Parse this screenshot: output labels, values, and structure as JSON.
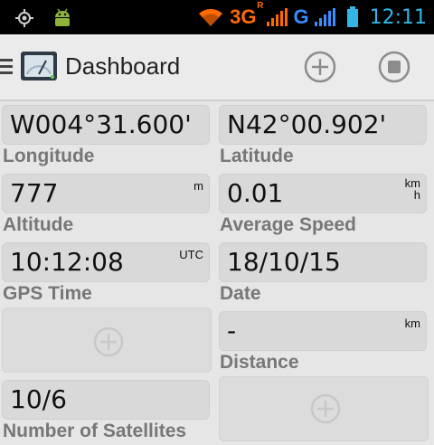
{
  "statusbar": {
    "left_icons": [
      "gps-target-icon",
      "android-debug-icon"
    ],
    "right_icons": [
      "wifi-icon",
      "signal-bars-orange-icon",
      "signal-bars-blue-icon",
      "battery-icon"
    ],
    "network_3g": "3G",
    "network_r": "R",
    "network_g": "G",
    "time": "12:11",
    "colors": {
      "wifi": "#ff6a00",
      "three_g": "#ff6a00",
      "g": "#3a8cff",
      "battery": "#33b5e5",
      "clock": "#33b5e5"
    }
  },
  "actionbar": {
    "title": "Dashboard",
    "icons": [
      "menu-icon",
      "dashboard-gauge-icon",
      "add-circle-icon",
      "stop-circle-icon"
    ]
  },
  "dashboard": {
    "longitude": {
      "value": "W004°31.600'",
      "unit": "",
      "label": "Longitude"
    },
    "latitude": {
      "value": "N42°00.902'",
      "unit": "",
      "label": "Latitude"
    },
    "altitude": {
      "value": "777",
      "unit": "m",
      "label": "Altitude"
    },
    "average_speed": {
      "value": "0.01",
      "unit_top": "km",
      "unit_bottom": "h",
      "label": "Average Speed"
    },
    "gps_time": {
      "value": "10:12:08",
      "unit": "UTC",
      "label": "GPS Time"
    },
    "date": {
      "value": "18/10/15",
      "unit": "",
      "label": "Date"
    },
    "distance": {
      "value": "-",
      "unit": "km",
      "label": "Distance"
    },
    "satellites": {
      "value": "10/6",
      "unit": "",
      "label": "Number of Satellites"
    },
    "empty_slots": [
      "add-widget-icon",
      "add-widget-icon"
    ]
  }
}
